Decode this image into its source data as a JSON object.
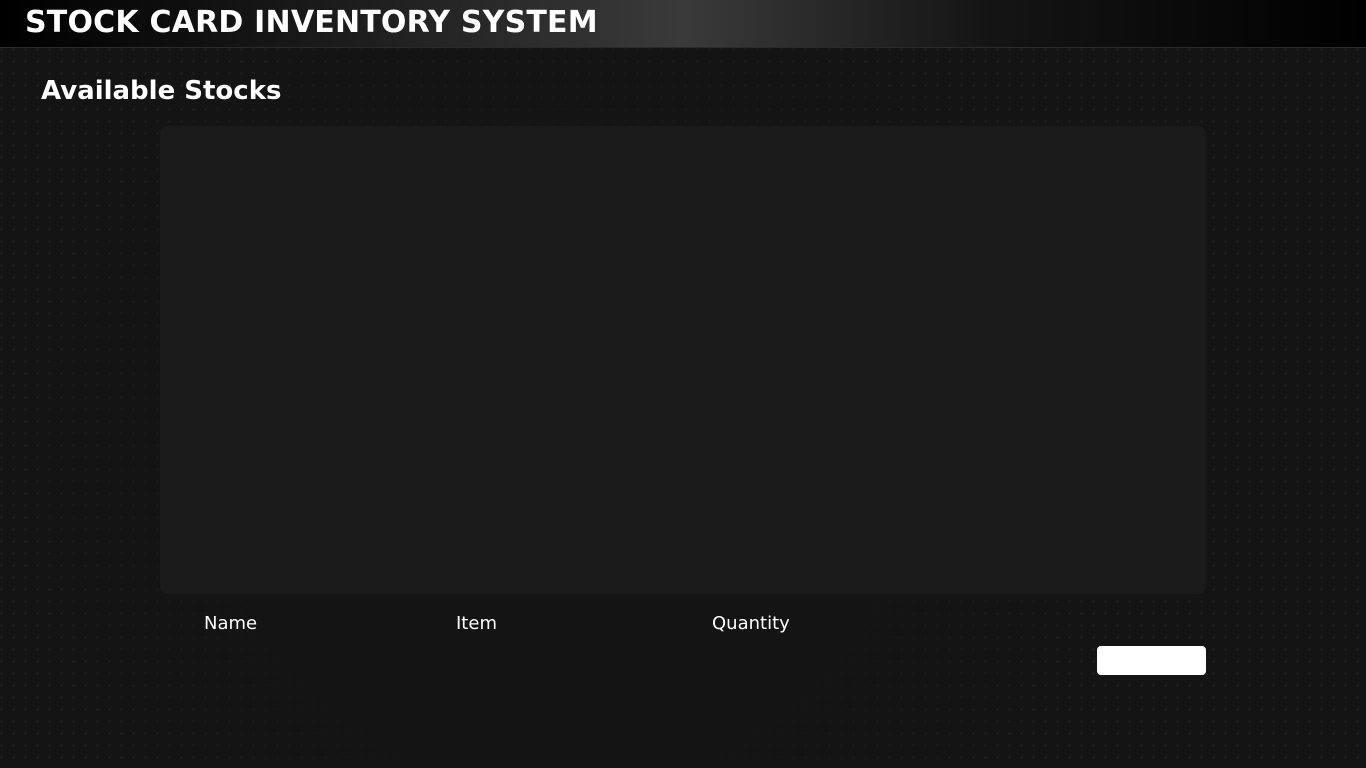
{
  "app": {
    "title": "STOCK CARD INVENTORY SYSTEM"
  },
  "main": {
    "section_title": "Available Stocks",
    "form": {
      "labels": {
        "name": "Name",
        "item": "Item",
        "quantity": "Quantity"
      },
      "button_label": ""
    }
  },
  "colors": {
    "background": "#141414",
    "panel": "#1b1b1b",
    "text": "#ffffff",
    "button": "#ffffff"
  }
}
